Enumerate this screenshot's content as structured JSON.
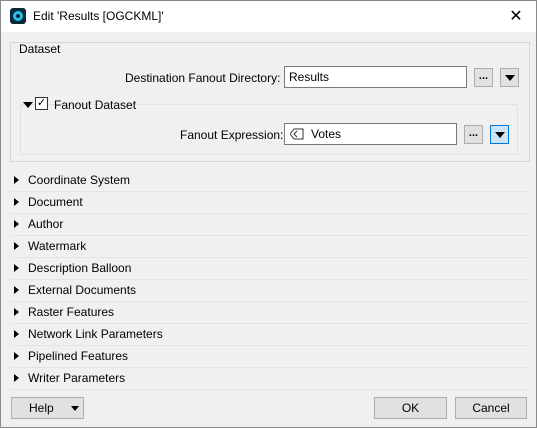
{
  "window": {
    "title": "Edit 'Results [OGCKML]'",
    "close_symbol": "✕"
  },
  "dataset": {
    "group_label": "Dataset",
    "destination_label": "Destination Fanout Directory:",
    "destination_value": "Results",
    "browse_label": "...",
    "fanout_checkbox_label": "Fanout Dataset",
    "fanout_checked": true,
    "expression_label": "Fanout Expression:",
    "expression_value": "Votes",
    "expression_browse_label": "..."
  },
  "sections": [
    {
      "label": "Coordinate System"
    },
    {
      "label": "Document"
    },
    {
      "label": "Author"
    },
    {
      "label": "Watermark"
    },
    {
      "label": "Description Balloon"
    },
    {
      "label": "External Documents"
    },
    {
      "label": "Raster Features"
    },
    {
      "label": "Network Link Parameters"
    },
    {
      "label": "Pipelined Features"
    },
    {
      "label": "Writer Parameters"
    }
  ],
  "footer": {
    "help_label": "Help",
    "ok_label": "OK",
    "cancel_label": "Cancel"
  },
  "colors": {
    "accent": "#0078d7",
    "window_bg": "#f0f0f0"
  }
}
